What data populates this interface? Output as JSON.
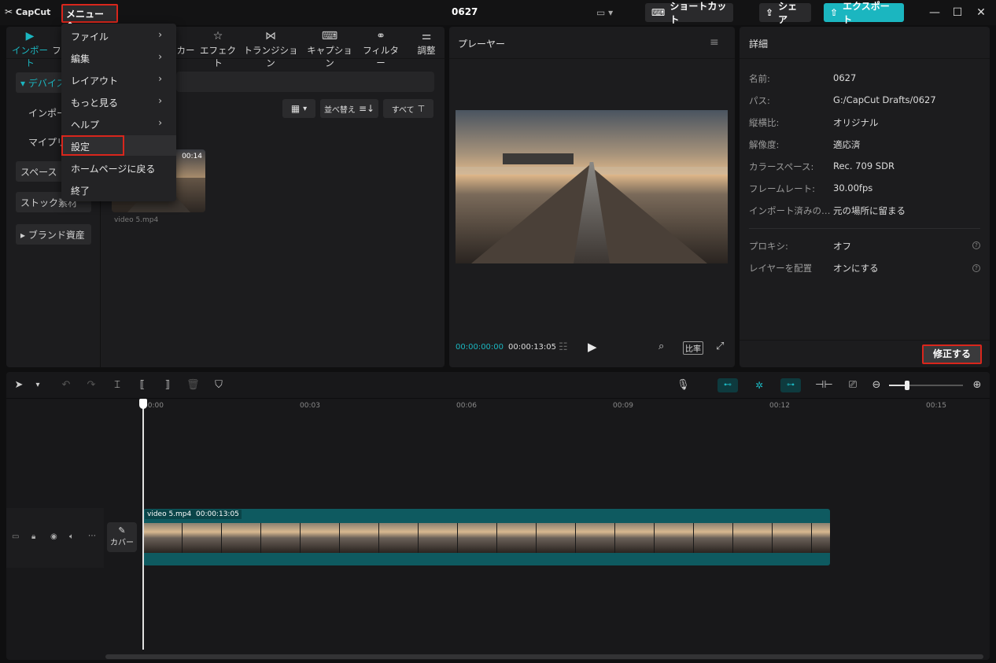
{
  "app": {
    "logo": "CapCut",
    "project_title": "0627"
  },
  "topbar": {
    "menu_label": "メニュー ^",
    "shortcut_label": "ショートカット",
    "share_label": "シェア",
    "export_label": "エクスポート"
  },
  "menu": {
    "items": [
      {
        "label": "ファイル",
        "chevron": "›"
      },
      {
        "label": "編集",
        "chevron": "›"
      },
      {
        "label": "レイアウト",
        "chevron": "›"
      },
      {
        "label": "もっと見る",
        "chevron": "›"
      },
      {
        "label": "ヘルプ",
        "chevron": "›"
      },
      {
        "label": "設定",
        "chevron": ""
      },
      {
        "label": "ホームページに戻る",
        "chevron": ""
      },
      {
        "label": "終了",
        "chevron": ""
      }
    ]
  },
  "media": {
    "tabs": [
      {
        "label": "インポート",
        "icon": "import-icon"
      },
      {
        "label": "フ",
        "icon": ""
      },
      {
        "label": "カー",
        "icon": ""
      },
      {
        "label": "エフェクト",
        "icon": "effects-icon"
      },
      {
        "label": "トランジション",
        "icon": "transition-icon"
      },
      {
        "label": "キャプション",
        "icon": "caption-icon"
      },
      {
        "label": "フィルター",
        "icon": "filter-icon"
      },
      {
        "label": "調整",
        "icon": "adjust-icon"
      }
    ],
    "sidebar": [
      {
        "label": "▾ デバイス"
      },
      {
        "label": "インポー"
      },
      {
        "label": "マイプリ"
      },
      {
        "label": "スペース"
      },
      {
        "label": "ストック素材"
      },
      {
        "label": "▸ ブランド資産"
      }
    ],
    "sort_label": "並べ替え",
    "filter_label": "すべて",
    "clip": {
      "duration": "00:14",
      "name": "video 5.mp4"
    }
  },
  "player": {
    "title": "プレーヤー",
    "current_time": "00:00:00:00",
    "total_time": "00:00:13:05",
    "ratio_label": "比率"
  },
  "details": {
    "title": "詳細",
    "rows": [
      {
        "key": "名前:",
        "value": "0627"
      },
      {
        "key": "パス:",
        "value": "G:/CapCut Drafts/0627"
      },
      {
        "key": "縦横比:",
        "value": "オリジナル"
      },
      {
        "key": "解像度:",
        "value": "適応済"
      },
      {
        "key": "カラースペース:",
        "value": "Rec. 709 SDR"
      },
      {
        "key": "フレームレート:",
        "value": "30.00fps"
      },
      {
        "key": "インポート済みの…",
        "value": "元の場所に留まる"
      }
    ],
    "rows2": [
      {
        "key": "プロキシ:",
        "value": "オフ"
      },
      {
        "key": "レイヤーを配置",
        "value": "オンにする"
      }
    ],
    "modify_label": "修正する"
  },
  "timeline": {
    "ruler": [
      "00:00",
      "00:03",
      "00:06",
      "00:09",
      "00:12",
      "00:15"
    ],
    "cover_label": "カバー",
    "clip_name": "video 5.mp4",
    "clip_duration": "00:00:13:05"
  },
  "colors": {
    "accent": "#1bb6c0",
    "highlight": "#d9261c",
    "clip": "#0e5a60"
  }
}
